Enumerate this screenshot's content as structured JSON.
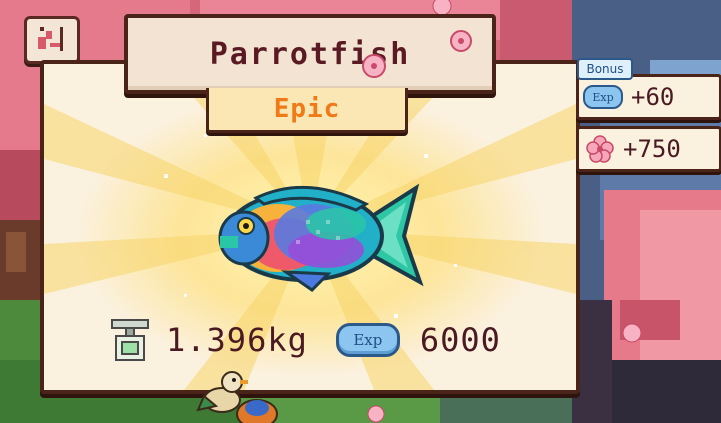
{
  "fish": {
    "name": "Parrotfish",
    "rarity": "Epic",
    "weight": "1.396kg",
    "exp_badge": "Exp",
    "exp_value": "6000"
  },
  "bonus": {
    "tag": "Bonus",
    "exp_badge": "Exp",
    "exp_amount": "+60",
    "petal_amount": "+750"
  },
  "icons": {
    "corner": "fishing-rod-character-icon",
    "weight": "scale-icon",
    "petal": "sakura-petal-icon"
  },
  "colors": {
    "title_text": "#5a1a24",
    "rarity_epic": "#f07a18",
    "exp_pill": "#8cc6f0",
    "frame": "#4a2418"
  }
}
